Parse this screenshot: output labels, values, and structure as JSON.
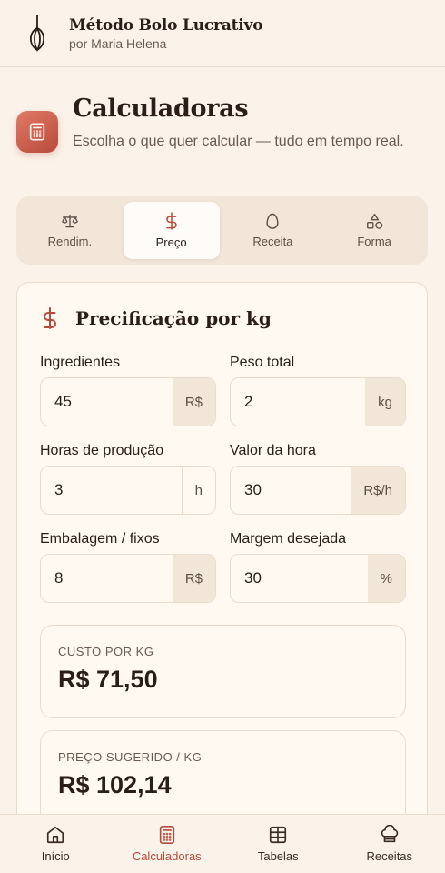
{
  "header": {
    "title": "Método Bolo Lucrativo",
    "subtitle": "por Maria Helena",
    "logo_icon": "whisk-icon"
  },
  "page": {
    "title": "Calculadoras",
    "description": "Escolha o que quer calcular — tudo em tempo real.",
    "icon": "calculator-icon"
  },
  "tabs": [
    {
      "label": "Rendim.",
      "icon": "scale-icon",
      "active": false
    },
    {
      "label": "Preço",
      "icon": "dollar-icon",
      "active": true
    },
    {
      "label": "Receita",
      "icon": "egg-icon",
      "active": false
    },
    {
      "label": "Forma",
      "icon": "shapes-icon",
      "active": false
    }
  ],
  "card": {
    "title": "Precificação por kg",
    "title_icon": "dollar-icon",
    "fields": {
      "ingredientes": {
        "label": "Ingredientes",
        "value": "45",
        "unit": "R$"
      },
      "peso_total": {
        "label": "Peso total",
        "value": "2",
        "unit": "kg"
      },
      "horas": {
        "label": "Horas de produção",
        "value": "3",
        "unit": "h"
      },
      "valor_hora": {
        "label": "Valor da hora",
        "value": "30",
        "unit": "R$/h"
      },
      "embalagem": {
        "label": "Embalagem / fixos",
        "value": "8",
        "unit": "R$"
      },
      "margem": {
        "label": "Margem desejada",
        "value": "30",
        "unit": "%"
      }
    },
    "results": [
      {
        "label": "CUSTO POR KG",
        "value": "R$ 71,50"
      },
      {
        "label": "PREÇO SUGERIDO / KG",
        "value": "R$ 102,14"
      }
    ]
  },
  "bottom_nav": [
    {
      "label": "Início",
      "icon": "home-icon",
      "active": false
    },
    {
      "label": "Calculadoras",
      "icon": "calculator-icon",
      "active": true
    },
    {
      "label": "Tabelas",
      "icon": "table-icon",
      "active": false
    },
    {
      "label": "Receitas",
      "icon": "chef-hat-icon",
      "active": false
    }
  ],
  "colors": {
    "background": "#FBF3EA",
    "accent": "#B84A3B",
    "text": "#2B1D17",
    "muted": "#6A5A51",
    "border": "#EADBCC"
  }
}
